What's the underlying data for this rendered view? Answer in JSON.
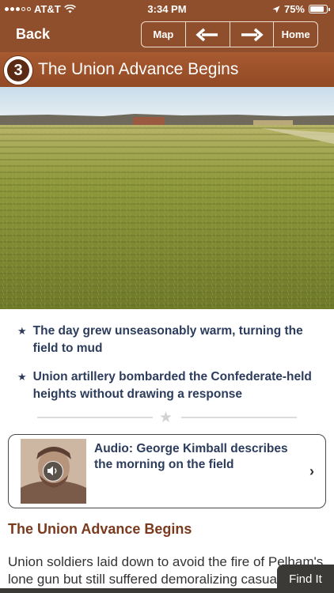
{
  "status_bar": {
    "carrier": "AT&T",
    "time": "3:34 PM",
    "battery": "75%"
  },
  "nav": {
    "back_label": "Back",
    "map_label": "Map",
    "prev_icon": "left-arrow-icon",
    "next_icon": "right-arrow-icon",
    "home_label": "Home"
  },
  "stop": {
    "number": "3",
    "title": "The Union Advance Begins"
  },
  "bullets": [
    "The day grew unseasonably warm, turning the field to mud",
    "Union artillery bombarded the Confederate-held heights without drawing a response"
  ],
  "audio": {
    "title": "Audio: George Kimball describes the morning on the field",
    "icon": "speaker-icon"
  },
  "section": {
    "heading": "The Union Advance Begins",
    "body": "Union soldiers laid down to avoid the fire of Pelham's lone gun but still suffered demoralizing casualties."
  },
  "find_it_label": "Find It",
  "colors": {
    "brand": "#8f4f2c",
    "heading": "#7a3a1e",
    "text": "#2c3c5c"
  }
}
